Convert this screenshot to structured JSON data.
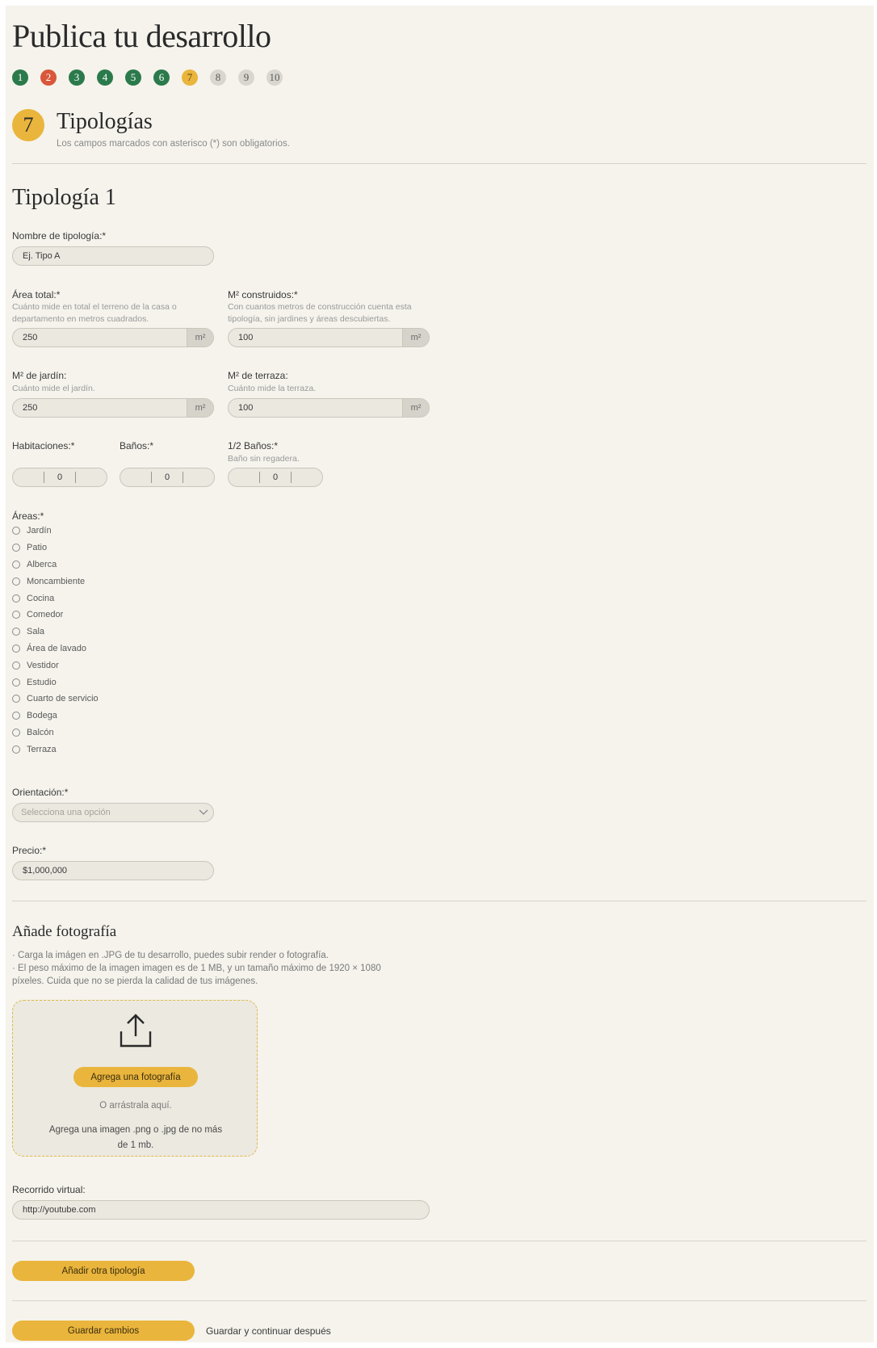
{
  "page_title": "Publica tu desarrollo",
  "steps": [
    {
      "n": "1",
      "state": "done"
    },
    {
      "n": "2",
      "state": "error"
    },
    {
      "n": "3",
      "state": "done"
    },
    {
      "n": "4",
      "state": "done"
    },
    {
      "n": "5",
      "state": "done"
    },
    {
      "n": "6",
      "state": "done"
    },
    {
      "n": "7",
      "state": "current"
    },
    {
      "n": "8",
      "state": "pending"
    },
    {
      "n": "9",
      "state": "pending"
    },
    {
      "n": "10",
      "state": "pending"
    }
  ],
  "section": {
    "number": "7",
    "title": "Tipologías",
    "subtitle": "Los campos marcados con asterisco (*) son obligatorios."
  },
  "typology": {
    "heading": "Tipología 1",
    "name": {
      "label": "Nombre de tipología:*",
      "value": "Ej. Tipo A"
    },
    "area_total": {
      "label": "Área total:*",
      "help_1": "Cuánto mide en total el terreno de la casa o",
      "help_2": "departamento en metros cuadrados.",
      "value": "250",
      "unit": "m²"
    },
    "m2_built": {
      "label": "M² construidos:*",
      "help_1": "Con cuantos metros de construcción cuenta esta",
      "help_2": "tipología, sin jardines y áreas descubiertas.",
      "value": "100",
      "unit": "m²"
    },
    "m2_garden": {
      "label": "M² de jardín:",
      "help": "Cuánto mide el jardín.",
      "value": "250",
      "unit": "m²"
    },
    "m2_terrace": {
      "label": "M² de terraza:",
      "help": "Cuánto mide la terraza.",
      "value": "100",
      "unit": "m²"
    },
    "bedrooms": {
      "label": "Habitaciones:*",
      "value": "0"
    },
    "bathrooms": {
      "label": "Baños:*",
      "value": "0"
    },
    "half_baths": {
      "label": "1/2 Baños:*",
      "help": "Baño sin regadera.",
      "value": "0"
    },
    "areas": {
      "label": "Áreas:*",
      "options": [
        "Jardín",
        "Patio",
        "Alberca",
        "Moncambiente",
        "Cocina",
        "Comedor",
        "Sala",
        "Área de lavado",
        "Vestidor",
        "Estudio",
        "Cuarto de servicio",
        "Bodega",
        "Balcón",
        "Terraza"
      ]
    },
    "orientation": {
      "label": "Orientación:*",
      "placeholder": "Selecciona una opción"
    },
    "price": {
      "label": "Precio:*",
      "value": "$1,000,000"
    }
  },
  "photo": {
    "heading": "Añade fotografía",
    "bullet_1": "· Carga la imágen en .JPG de tu desarrollo, puedes subir render o fotografía.",
    "bullet_2": "· El peso máximo de la imagen imagen es de 1 MB, y un tamaño máximo de 1920 × 1080",
    "bullet_3": "píxeles. Cuida que no se pierda la calidad de tus imágenes.",
    "button": "Agrega una fotografía",
    "drag_text": "O arrástrala aquí.",
    "hint_1": "Agrega una imagen .png o .jpg de no más",
    "hint_2": "de 1 mb."
  },
  "virtual_tour": {
    "label": "Recorrido virtual:",
    "value": "http://youtube.com"
  },
  "add_typology": "Añadir otra tipología",
  "save": "Guardar cambios",
  "save_later": "Guardar y continuar después",
  "colors": {
    "accent": "#eab53c",
    "done": "#2b7a4b",
    "error": "#d9573a",
    "pending": "#d8d6cf",
    "background": "#f5f3ec"
  }
}
